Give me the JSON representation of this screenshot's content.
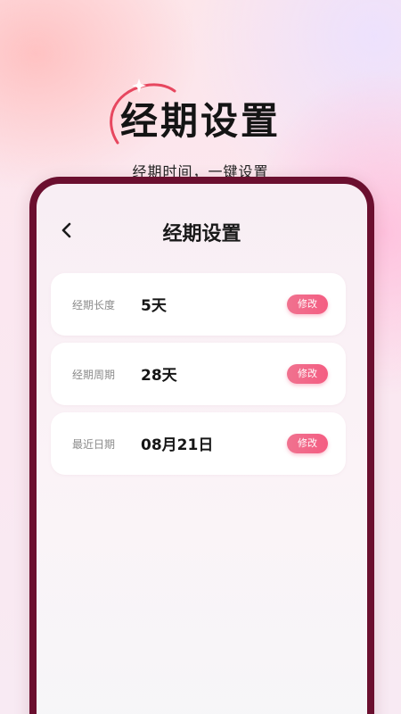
{
  "hero": {
    "title": "经期设置",
    "subtitle": "经期时间，一键设置"
  },
  "screen": {
    "title": "经期设置",
    "back_icon": "chevron-left-icon"
  },
  "items": [
    {
      "label": "经期长度",
      "value": "5天",
      "button": "修改"
    },
    {
      "label": "经期周期",
      "value": "28天",
      "button": "修改"
    },
    {
      "label": "最近日期",
      "value": "08月21日",
      "button": "修改"
    }
  ],
  "colors": {
    "frame": "#6b0f2f",
    "accent": "#f45d82"
  }
}
